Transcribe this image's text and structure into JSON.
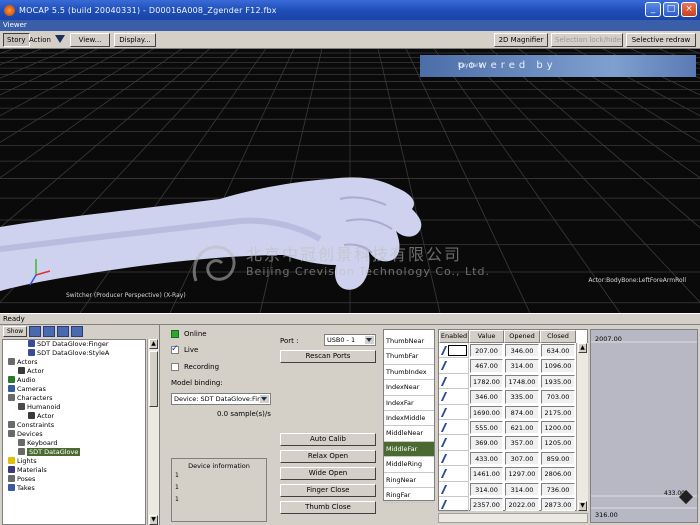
{
  "window": {
    "title": "MOCAP 5.5 (build 20040331) - D00016A008_Zgender F12.fbx",
    "viewer_label": "Viewer",
    "status": "Ready"
  },
  "toolbar": {
    "story_label": "Story",
    "action_label": "Action",
    "view_label": "View...",
    "display_label": "Display...",
    "magnifier_label": "2D Magnifier",
    "disabled_label": "Selection lock/hide",
    "redraw_label": "Selective redraw"
  },
  "viewport": {
    "banner_text": "powered by",
    "banner_brand": "kaydara",
    "camera_label": "Switcher (Producer Perspective) (X-Ray)",
    "bone_label": "Actor:BodyBone:LeftForeArmRoll",
    "watermark_cn": "北京中冠创景科技有限公司",
    "watermark_en": "Beijing Crevision Technology Co., Ltd."
  },
  "tree": {
    "show_label": "Show",
    "items": [
      {
        "label": "SDT DataGlove:Finger",
        "indent": 5,
        "color": "#3a4a9a"
      },
      {
        "label": "SDT DataGlove:StyleA",
        "indent": 5,
        "color": "#3a4a9a"
      },
      {
        "label": "Actors",
        "indent": 1,
        "color": "#6a6a6a"
      },
      {
        "label": "Actor",
        "indent": 3,
        "color": "#3a3a3a"
      },
      {
        "label": "Audio",
        "indent": 1,
        "color": "#2a7a2a"
      },
      {
        "label": "Cameras",
        "indent": 1,
        "color": "#3a5aa0"
      },
      {
        "label": "Characters",
        "indent": 1,
        "color": "#6a6a6a"
      },
      {
        "label": "Humanoid",
        "indent": 3,
        "color": "#4a4a4a"
      },
      {
        "label": "Actor",
        "indent": 5,
        "color": "#3a3a3a"
      },
      {
        "label": "Constraints",
        "indent": 1,
        "color": "#6a6a6a"
      },
      {
        "label": "Devices",
        "indent": 1,
        "color": "#6a6a6a"
      },
      {
        "label": "Keyboard",
        "indent": 3,
        "color": "#6a6a6a"
      },
      {
        "label": "SDT DataGlove",
        "indent": 3,
        "color": "#6a6a6a",
        "selected": true
      },
      {
        "label": "Lights",
        "indent": 1,
        "color": "#e0c000"
      },
      {
        "label": "Materials",
        "indent": 1,
        "color": "#3a3a7a"
      },
      {
        "label": "Poses",
        "indent": 1,
        "color": "#6a6a6a"
      },
      {
        "label": "Takes",
        "indent": 1,
        "color": "#3a5aa0"
      }
    ]
  },
  "device": {
    "online_label": "Online",
    "live_label": "Live",
    "recording_label": "Recording",
    "model_binding_label": "Model binding:",
    "model_binding_value": "Device: SDT DataGlove:Finge",
    "sample_rate": "0.0 sample(s)/s",
    "info_title": "Device information",
    "info_lines": [
      "1",
      "1",
      "1"
    ]
  },
  "port": {
    "label": "Port :",
    "value": "USB0 - 1",
    "rescan_label": "Rescan Ports",
    "actions": [
      "Auto Calib",
      "Relax Open",
      "Wide Open",
      "Finger Close",
      "Thumb Close"
    ]
  },
  "table": {
    "headers": [
      "Enabled",
      "Value",
      "Opened",
      "Closed"
    ],
    "rows": [
      {
        "name": "ThumbNear",
        "value": "207.00",
        "opened": "346.00",
        "closed": "634.00"
      },
      {
        "name": "ThumbFar",
        "value": "467.00",
        "opened": "314.00",
        "closed": "1096.00"
      },
      {
        "name": "ThumbIndex",
        "value": "1782.00",
        "opened": "1748.00",
        "closed": "1935.00"
      },
      {
        "name": "IndexNear",
        "value": "346.00",
        "opened": "335.00",
        "closed": "703.00"
      },
      {
        "name": "IndexFar",
        "value": "1690.00",
        "opened": "874.00",
        "closed": "2175.00"
      },
      {
        "name": "IndexMiddle",
        "value": "555.00",
        "opened": "621.00",
        "closed": "1200.00"
      },
      {
        "name": "MiddleNear",
        "value": "369.00",
        "opened": "357.00",
        "closed": "1205.00"
      },
      {
        "name": "MiddleFar",
        "value": "433.00",
        "opened": "307.00",
        "closed": "859.00",
        "selected": true
      },
      {
        "name": "MiddleRing",
        "value": "1461.00",
        "opened": "1297.00",
        "closed": "2806.00"
      },
      {
        "name": "RingNear",
        "value": "314.00",
        "opened": "314.00",
        "closed": "736.00"
      },
      {
        "name": "RingFar",
        "value": "2357.00",
        "opened": "2022.00",
        "closed": "2873.00"
      }
    ]
  },
  "graph": {
    "top_value": "2007.00",
    "bottom_value": "316.00",
    "marker_value": "433.00"
  }
}
